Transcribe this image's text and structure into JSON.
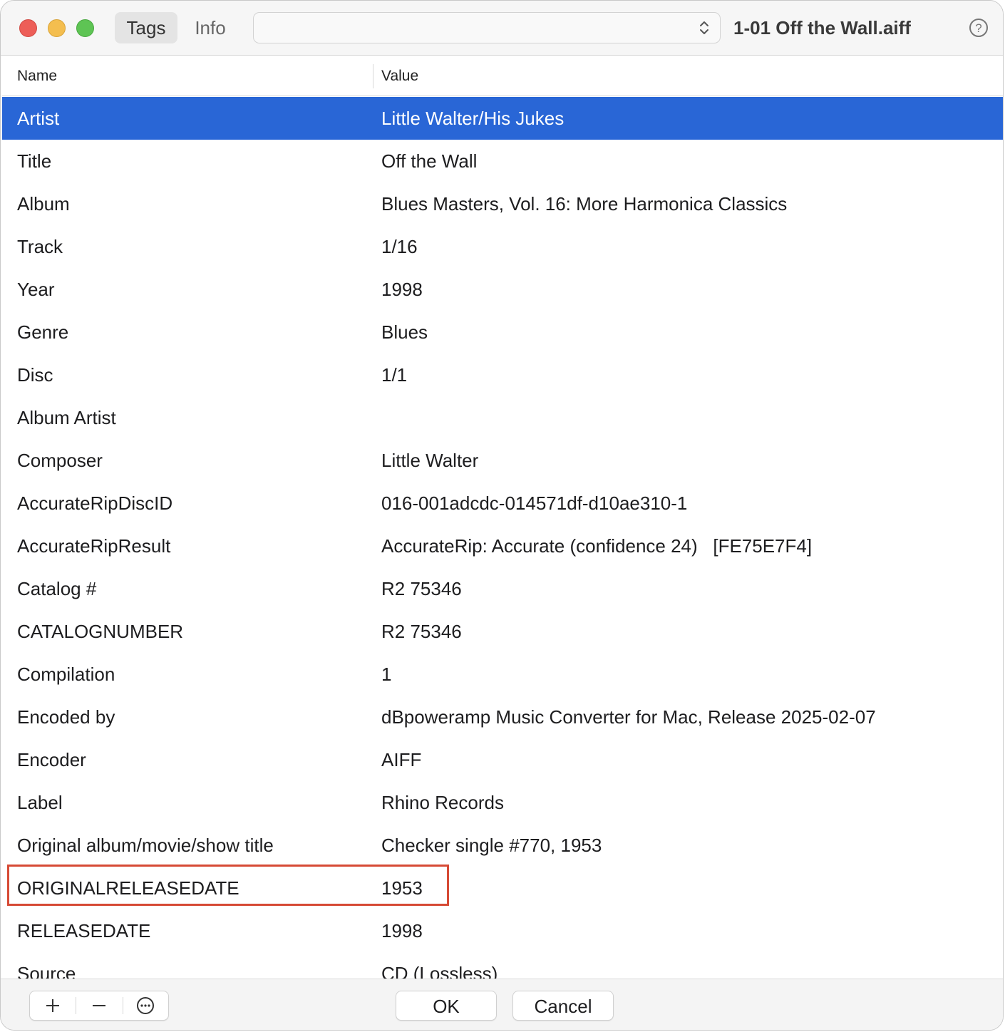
{
  "toolbar": {
    "tabs": [
      {
        "label": "Tags"
      },
      {
        "label": "Info"
      }
    ],
    "preset_value": "",
    "filename": "1-01 Off the Wall.aiff",
    "help_icon": "question-mark-circle-icon"
  },
  "table": {
    "columns": [
      "Name",
      "Value"
    ],
    "rows": [
      {
        "name": "Artist",
        "value": "Little Walter/His Jukes"
      },
      {
        "name": "Title",
        "value": "Off the Wall"
      },
      {
        "name": "Album",
        "value": "Blues Masters, Vol. 16: More Harmonica Classics"
      },
      {
        "name": "Track",
        "value": "1/16"
      },
      {
        "name": "Year",
        "value": "1998"
      },
      {
        "name": "Genre",
        "value": "Blues"
      },
      {
        "name": "Disc",
        "value": "1/1"
      },
      {
        "name": "Album Artist",
        "value": ""
      },
      {
        "name": "Composer",
        "value": "Little Walter"
      },
      {
        "name": "AccurateRipDiscID",
        "value": "016-001adcdc-014571df-d10ae310-1"
      },
      {
        "name": "AccurateRipResult",
        "value": "AccurateRip: Accurate (confidence 24)   [FE75E7F4]"
      },
      {
        "name": "Catalog #",
        "value": "R2 75346"
      },
      {
        "name": "CATALOGNUMBER",
        "value": "R2 75346"
      },
      {
        "name": "Compilation",
        "value": "1"
      },
      {
        "name": "Encoded by",
        "value": "dBpoweramp Music Converter for Mac, Release 2025-02-07"
      },
      {
        "name": "Encoder",
        "value": "AIFF"
      },
      {
        "name": "Label",
        "value": "Rhino Records"
      },
      {
        "name": "Original album/movie/show title",
        "value": "Checker single #770, 1953"
      },
      {
        "name": "ORIGINALRELEASEDATE",
        "value": "1953"
      },
      {
        "name": "RELEASEDATE",
        "value": "1998"
      },
      {
        "name": "Source",
        "value": "CD (Lossless)"
      }
    ]
  },
  "bottom": {
    "add_icon": "plus-icon",
    "remove_icon": "minus-icon",
    "more_icon": "ellipsis-circle-icon",
    "ok_label": "OK",
    "cancel_label": "Cancel"
  },
  "colors": {
    "selection": "#2966d6",
    "highlight_box": "#d64a35"
  }
}
